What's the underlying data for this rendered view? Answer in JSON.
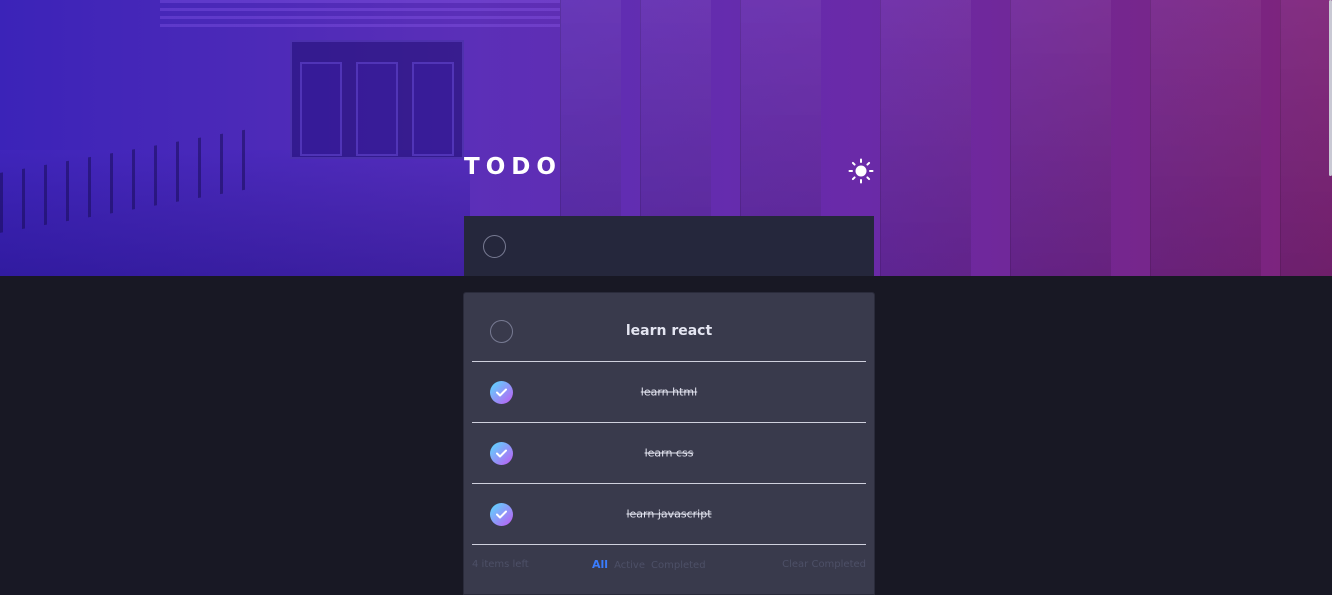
{
  "app": {
    "title": "TODO",
    "theme_toggle_icon": "sun-icon"
  },
  "new_todo": {
    "value": "",
    "placeholder": ""
  },
  "todos": [
    {
      "label": "learn react",
      "completed": false
    },
    {
      "label": "learn html",
      "completed": true
    },
    {
      "label": "learn css",
      "completed": true
    },
    {
      "label": "learn javascript",
      "completed": true
    }
  ],
  "footer": {
    "items_left": "4 items left",
    "filters": [
      "All",
      "Active",
      "Completed"
    ],
    "selected_filter": "All",
    "clear_label": "Clear Completed"
  },
  "colors": {
    "accent": "#3a7cfd",
    "check_gradient_start": "#57ddff",
    "check_gradient_end": "#c058f3",
    "page_background": "#181824",
    "card_background": "#393a4c",
    "input_background": "#25273c"
  }
}
